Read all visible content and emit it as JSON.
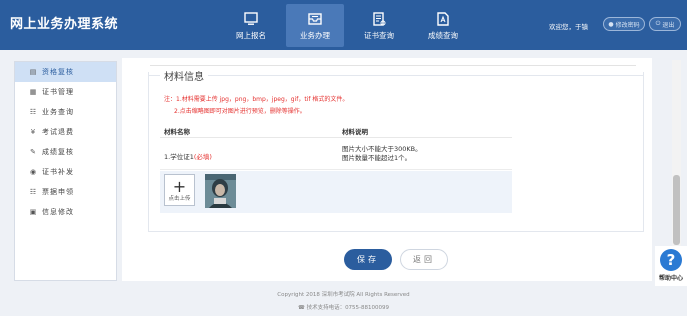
{
  "app": {
    "title": "网上业务办理系统"
  },
  "nav": [
    {
      "label": "网上报名",
      "icon": "monitor-icon"
    },
    {
      "label": "业务办理",
      "icon": "inbox-icon"
    },
    {
      "label": "证书查询",
      "icon": "certificate-icon"
    },
    {
      "label": "成绩查询",
      "icon": "score-icon"
    }
  ],
  "header": {
    "welcome": "欢迎您，于镇",
    "change_password": "修改密码",
    "logout": "退出"
  },
  "sidebar": [
    {
      "label": "资格复核",
      "icon": "document-icon"
    },
    {
      "label": "证书管理",
      "icon": "certificate-icon"
    },
    {
      "label": "业务查询",
      "icon": "sitemap-icon"
    },
    {
      "label": "考试退费",
      "icon": "yen-icon"
    },
    {
      "label": "成绩复核",
      "icon": "edit-icon"
    },
    {
      "label": "证书补发",
      "icon": "reissue-icon"
    },
    {
      "label": "票据申领",
      "icon": "sitemap-icon"
    },
    {
      "label": "信息修改",
      "icon": "info-icon"
    }
  ],
  "material": {
    "legend": "材料信息",
    "note1": "注：1.材料需要上传 jpg，png，bmp，jpeg，gif，tif 格式的文件。",
    "note2": "2.点击缩略图即可对图片进行预览，删除等操作。",
    "col_name": "材料名称",
    "col_desc": "材料说明",
    "row_name": "1.学位证1",
    "row_required": "(必填)",
    "row_desc1": "图片大小不能大于300KB。",
    "row_desc2": "图片数量不能超过1个。",
    "upload_label": "点击上传"
  },
  "buttons": {
    "save": "保存",
    "back": "返回"
  },
  "footer": {
    "copyright": "Copyright 2018 深圳市考试院 All Rights Reserved",
    "support": "技术支持电话：0755-88100099"
  },
  "help": {
    "label": "帮助中心"
  }
}
